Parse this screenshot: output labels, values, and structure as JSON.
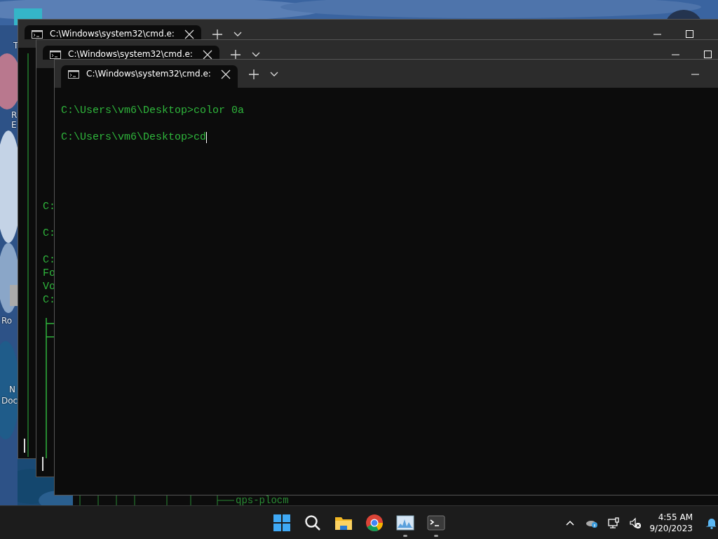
{
  "desktop": {
    "icon_labels": [
      {
        "text": "T"
      },
      {
        "text": "R"
      },
      {
        "text": "E"
      },
      {
        "text": "Ro"
      },
      {
        "text": "N"
      },
      {
        "text": "Doc"
      }
    ]
  },
  "background_terminal": {
    "text": "qps-plocm"
  },
  "windows": [
    {
      "kind": "long",
      "tab_title": "C:\\Windows\\system32\\cmd.e:",
      "controls": [
        {
          "kind": "minimize"
        },
        {
          "kind": "maximize"
        }
      ],
      "cursor": true
    },
    {
      "kind": "branch",
      "tab_title": "C:\\Windows\\system32\\cmd.e:",
      "controls": [
        {
          "kind": "minimize"
        },
        {
          "kind": "maximize"
        }
      ],
      "blocks": [
        [
          "C:"
        ],
        [
          "C:"
        ],
        [
          "C:",
          "Fo",
          "Vo",
          "C:"
        ]
      ],
      "cursor": true
    },
    {
      "kind": "plain",
      "tab_title": "C:\\Windows\\system32\\cmd.e:",
      "controls": [
        {
          "kind": "minimize"
        }
      ],
      "blocks": [
        [
          "C:\\Users\\vm6\\Desktop>color 0a"
        ],
        [
          "C:\\Users\\vm6\\Desktop>cd"
        ]
      ],
      "cursor": true
    }
  ],
  "taskbar": {
    "apps": [
      {
        "kind": "start",
        "running": false
      },
      {
        "kind": "search",
        "running": false
      },
      {
        "kind": "folder",
        "running": false
      },
      {
        "kind": "browser",
        "running": false
      },
      {
        "kind": "monitor",
        "running": true
      },
      {
        "kind": "terminal",
        "running": true
      }
    ],
    "tray": [
      {
        "kind": "chevron"
      },
      {
        "kind": "cloud"
      },
      {
        "kind": "network"
      },
      {
        "kind": "muted"
      }
    ],
    "time": "4:55 AM",
    "date": "9/20/2023"
  }
}
